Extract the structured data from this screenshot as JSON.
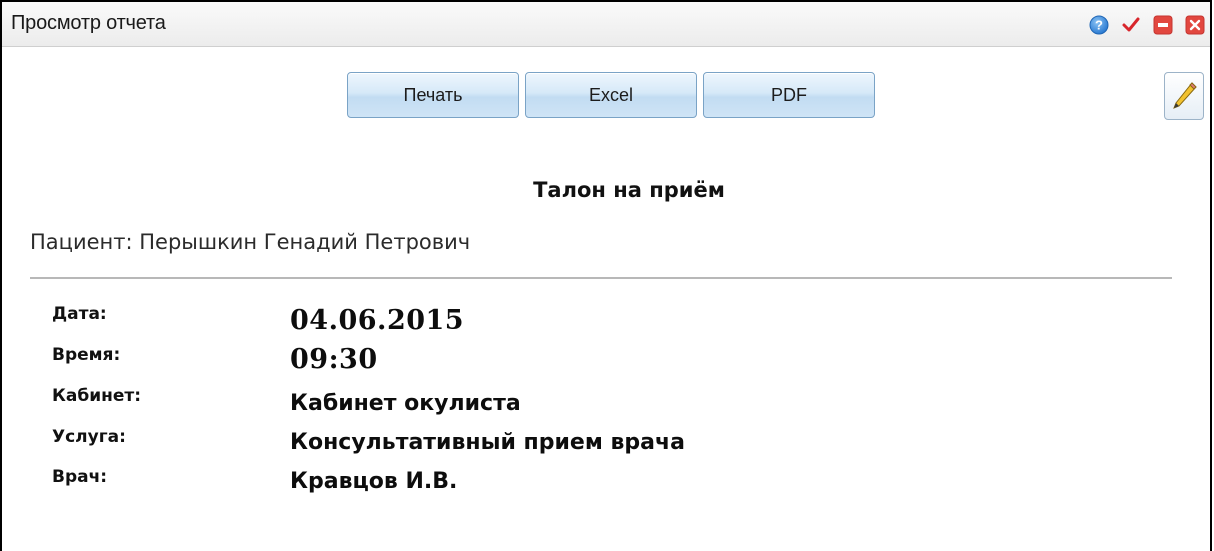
{
  "window": {
    "title": "Просмотр отчета",
    "controls": {
      "help_icon": "help-icon",
      "apply_icon": "checkmark-icon",
      "minimize_icon": "minimize-icon",
      "close_icon": "close-icon"
    }
  },
  "toolbar": {
    "print_label": "Печать",
    "excel_label": "Excel",
    "pdf_label": "PDF",
    "edit_icon": "pencil-icon"
  },
  "report": {
    "title": "Талон на приём",
    "patient": "Пациент: Перышкин Генадий Петрович",
    "fields": [
      {
        "label": "Дата:",
        "value": "04.06.2015"
      },
      {
        "label": "Время:",
        "value": "09:30"
      },
      {
        "label": "Кабинет:",
        "value": "Кабинет окулиста"
      },
      {
        "label": "Услуга:",
        "value": "Консультативный прием врача"
      },
      {
        "label": "Врач:",
        "value": "Кравцов И.В."
      }
    ]
  },
  "colors": {
    "help": "#3d8fe0",
    "check": "#d8262c",
    "window_buttons": "#e2473f",
    "button_border": "#7aa3c6"
  }
}
